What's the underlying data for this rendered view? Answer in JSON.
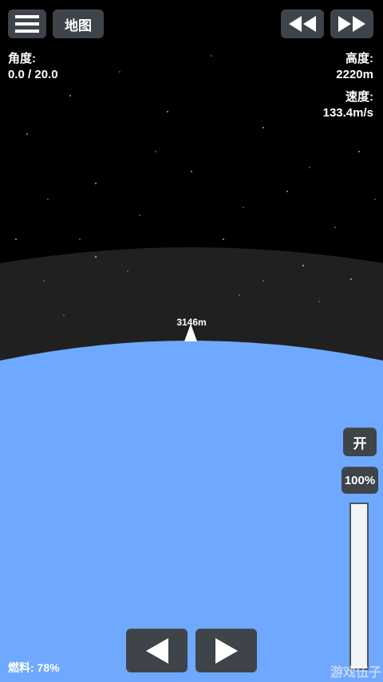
{
  "hud": {
    "map_label": "地图",
    "angle_label": "角度:",
    "angle_value": "0.0 / 20.0",
    "altitude_label": "高度:",
    "altitude_value": "2220m",
    "speed_label": "速度:",
    "speed_value": "133.4m/s",
    "fuel_text": "燃料: 78%"
  },
  "marker": {
    "label": "3146m"
  },
  "throttle": {
    "toggle_label": "开",
    "percent_label": "100%",
    "level": 1.0
  },
  "watermark": "游戏伍子",
  "icons": {
    "menu": "hamburger-menu-icon",
    "rewind": "rewind-icon",
    "fast_forward": "fast-forward-icon",
    "rotate_left": "triangle-left-icon",
    "rotate_right": "triangle-right-icon",
    "rocket": "rocket-marker-icon"
  },
  "colors": {
    "space": "#000000",
    "atmosphere": "#202020",
    "ground": "#6fa8ff",
    "button": "#3f444a"
  }
}
